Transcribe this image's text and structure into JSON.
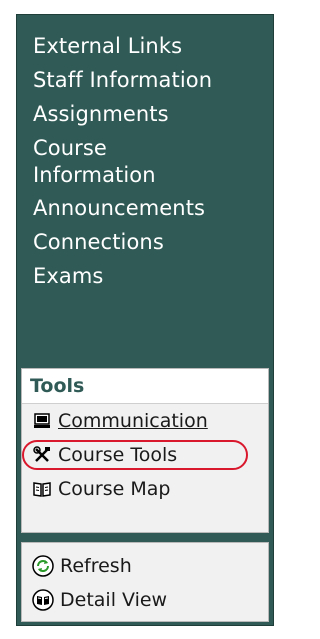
{
  "nav": {
    "items": [
      {
        "label": "External Links"
      },
      {
        "label": "Staff Information"
      },
      {
        "label": "Assignments"
      },
      {
        "label": "Course"
      },
      {
        "label": "Information"
      },
      {
        "label": "Announcements"
      },
      {
        "label": "Connections"
      },
      {
        "label": "Exams"
      }
    ]
  },
  "tools": {
    "header": "Tools",
    "items": [
      {
        "label": "Communication",
        "icon": "monitor-icon"
      },
      {
        "label": "Course Tools",
        "icon": "tools-icon"
      },
      {
        "label": "Course Map",
        "icon": "book-map-icon"
      }
    ]
  },
  "actions": {
    "items": [
      {
        "label": "Refresh",
        "icon": "refresh-icon"
      },
      {
        "label": "Detail View",
        "icon": "detail-view-icon"
      }
    ]
  },
  "colors": {
    "frame": "#2f5a55",
    "panel": "#f1f1f1",
    "highlight": "#d9182d"
  }
}
